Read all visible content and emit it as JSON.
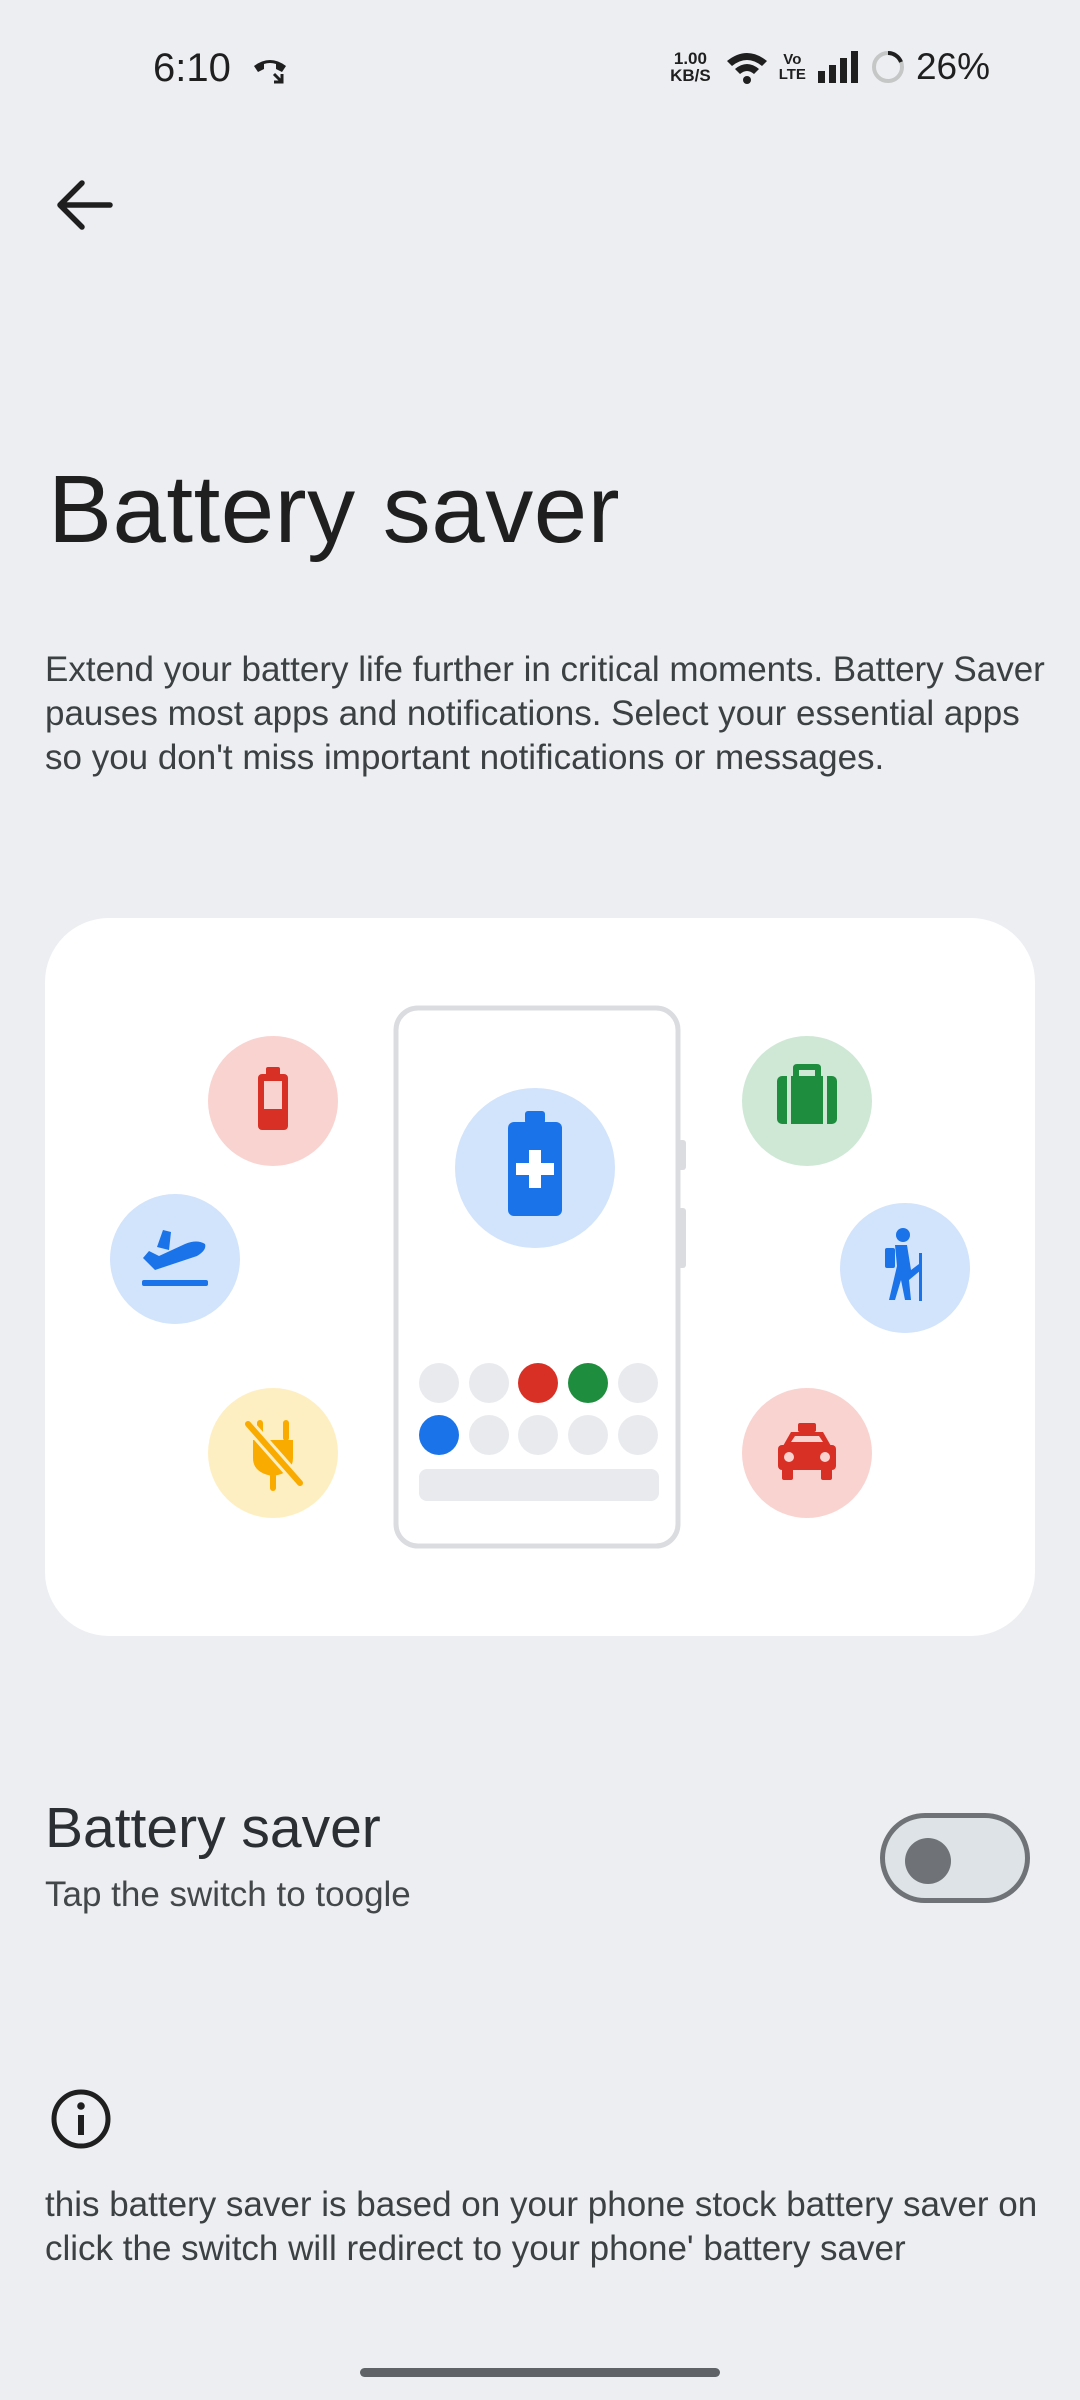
{
  "status_bar": {
    "time": "6:10",
    "speed_value": "1.00",
    "speed_unit": "KB/S",
    "volte_top": "Vo",
    "volte_bottom": "LTE",
    "battery_percent": "26%",
    "icons": [
      "call-icon",
      "wifi-icon",
      "volte-icon",
      "signal-icon",
      "battery-ring-icon"
    ]
  },
  "header": {
    "back_icon": "arrow-left-icon",
    "title": "Battery saver"
  },
  "description": "Extend your battery life further in critical moments. Battery Saver pauses most apps and notifications. Select your essential apps so you don't miss important notifications or messages.",
  "illustration": {
    "icons": [
      "battery-low-icon",
      "airplane-takeoff-icon",
      "no-charging-icon",
      "battery-plus-icon",
      "briefcase-icon",
      "hiking-icon",
      "taxi-icon"
    ],
    "colors": {
      "red": "#d93025",
      "red_bg": "#f9d3d0",
      "green": "#1e8e3e",
      "green_bg": "#cfe8d6",
      "blue": "#1a73e8",
      "blue_bg": "#d2e3fc",
      "yellow": "#f9ab00",
      "yellow_bg": "#feefc3",
      "grey_dot": "#e8eaed"
    }
  },
  "setting": {
    "title": "Battery saver",
    "subtitle": "Tap the switch to toogle",
    "switch_on": false
  },
  "info": {
    "icon": "info-icon",
    "text": "this battery saver is based on your phone stock battery saver on click the switch will redirect to your phone' battery saver"
  }
}
